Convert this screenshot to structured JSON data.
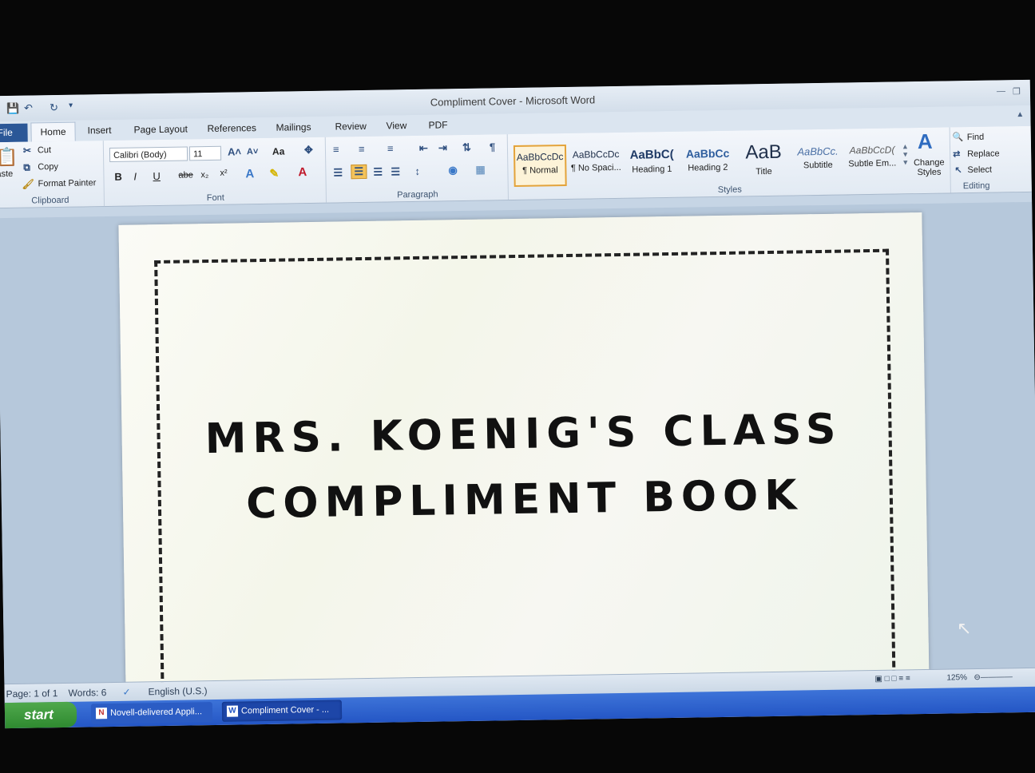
{
  "window": {
    "title": "Compliment Cover",
    "separator": " - ",
    "app": "Microsoft Word"
  },
  "tabs": [
    "File",
    "Home",
    "Insert",
    "Page Layout",
    "References",
    "Mailings",
    "Review",
    "View",
    "PDF"
  ],
  "clipboard": {
    "paste": "aste",
    "cut": "Cut",
    "copy": "Copy",
    "format_painter": "Format Painter",
    "label": "Clipboard"
  },
  "font": {
    "name": "Calibri (Body)",
    "size": "11",
    "change_case": "Aa",
    "bold": "B",
    "italic": "I",
    "underline": "U",
    "strikethrough": "abe",
    "subscript": "x₂",
    "superscript": "x²",
    "label": "Font"
  },
  "paragraph": {
    "label": "Paragraph"
  },
  "styles": {
    "items": [
      {
        "sample": "AaBbCcDc",
        "name": "¶ Normal"
      },
      {
        "sample": "AaBbCcDc",
        "name": "¶ No Spaci..."
      },
      {
        "sample": "AaBbC(",
        "name": "Heading 1"
      },
      {
        "sample": "AaBbCc",
        "name": "Heading 2"
      },
      {
        "sample": "AaB",
        "name": "Title"
      },
      {
        "sample": "AaBbCc.",
        "name": "Subtitle"
      },
      {
        "sample": "AaBbCcD(",
        "name": "Subtle Em..."
      }
    ],
    "change_styles": "Change Styles",
    "label": "Styles"
  },
  "editing": {
    "find": "Find",
    "replace": "Replace",
    "select": "Select",
    "label": "Editing"
  },
  "document": {
    "line1": "MRS. KOENIG'S CLASS",
    "line2": "COMPLIMENT BOOK"
  },
  "status": {
    "page": "Page: 1 of 1",
    "words": "Words: 6",
    "language": "English (U.S.)",
    "zoom": "125%"
  },
  "taskbar": {
    "start": "start",
    "task1": "Novell-delivered Appli...",
    "task2": "Compliment Cover - ..."
  },
  "colors": {
    "accent": "#2b5797",
    "taskbar": "#2456c5",
    "start": "#3a9a3a"
  }
}
